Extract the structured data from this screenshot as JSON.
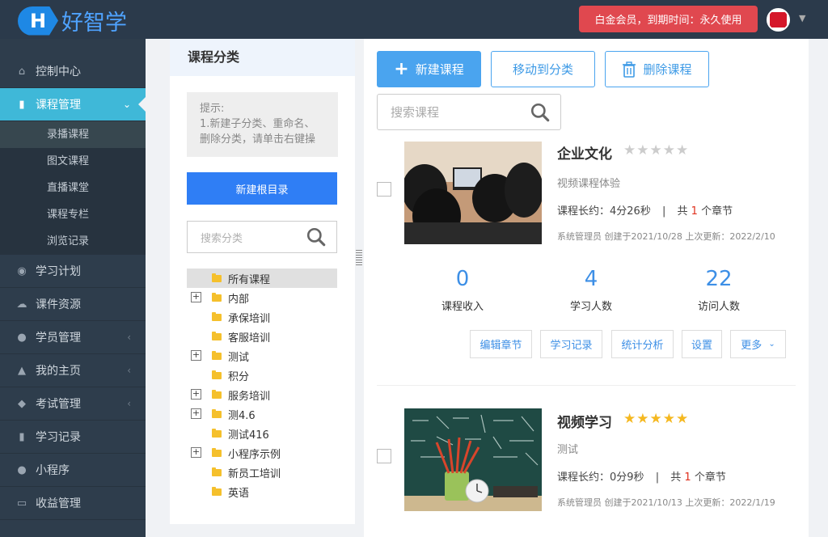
{
  "brand": {
    "logo_letter": "H",
    "name": "好智学"
  },
  "header": {
    "membership": "白金会员，到期时间：永久使用"
  },
  "sidebar": {
    "items": [
      {
        "label": "控制中心",
        "icon": "home-icon"
      },
      {
        "label": "课程管理",
        "icon": "book-icon"
      },
      {
        "label": "学习计划",
        "icon": "eye-icon"
      },
      {
        "label": "课件资源",
        "icon": "cloud-icon"
      },
      {
        "label": "学员管理",
        "icon": "users-icon"
      },
      {
        "label": "我的主页",
        "icon": "graduation-icon"
      },
      {
        "label": "考试管理",
        "icon": "tag-icon"
      },
      {
        "label": "学习记录",
        "icon": "notebook-icon"
      },
      {
        "label": "小程序",
        "icon": "wechat-icon"
      },
      {
        "label": "收益管理",
        "icon": "card-icon"
      }
    ],
    "submenu": [
      "录播课程",
      "图文课程",
      "直播课堂",
      "课程专栏",
      "浏览记录"
    ]
  },
  "category": {
    "title": "课程分类",
    "tip": [
      "提示:",
      "1.新建子分类、重命名、",
      "删除分类，请单击右键操"
    ],
    "new_root": "新建根目录",
    "search_placeholder": "搜索分类",
    "tree": [
      "所有课程",
      "内部",
      "承保培训",
      "客服培训",
      "测试",
      "积分",
      "服务培训",
      "测4.6",
      "测试416",
      "小程序示例",
      "新员工培训",
      "英语"
    ]
  },
  "toolbar": {
    "new_course": "新建课程",
    "move": "移动到分类",
    "delete": "删除课程",
    "search_placeholder": "搜索课程"
  },
  "courses": [
    {
      "title": "企业文化",
      "rating": 0,
      "desc": "视频课程体验",
      "length_label": "课程长约：",
      "length": "4分26秒",
      "divider": "|",
      "chapter_prefix": "共",
      "chapters": "1",
      "chapter_suffix": "个章节",
      "meta": "系统管理员 创建于2021/10/28 上次更新：2022/2/10",
      "stats": [
        {
          "value": "0",
          "label": "课程收入"
        },
        {
          "value": "4",
          "label": "学习人数"
        },
        {
          "value": "22",
          "label": "访问人数"
        }
      ],
      "actions": [
        "编辑章节",
        "学习记录",
        "统计分析",
        "设置",
        "更多"
      ]
    },
    {
      "title": "视频学习",
      "rating": 5,
      "desc": "测试",
      "length_label": "课程长约：",
      "length": "0分9秒",
      "divider": "|",
      "chapter_prefix": "共",
      "chapters": "1",
      "chapter_suffix": "个章节",
      "meta": "系统管理员 创建于2021/10/13 上次更新：2022/1/19"
    }
  ],
  "colors": {
    "sidebar": "#2e3d4c",
    "active": "#3fb8d8",
    "primary": "#4aa4ef",
    "vip": "#e0484f",
    "star_on": "#f5b820",
    "star_off": "#cccccc"
  }
}
